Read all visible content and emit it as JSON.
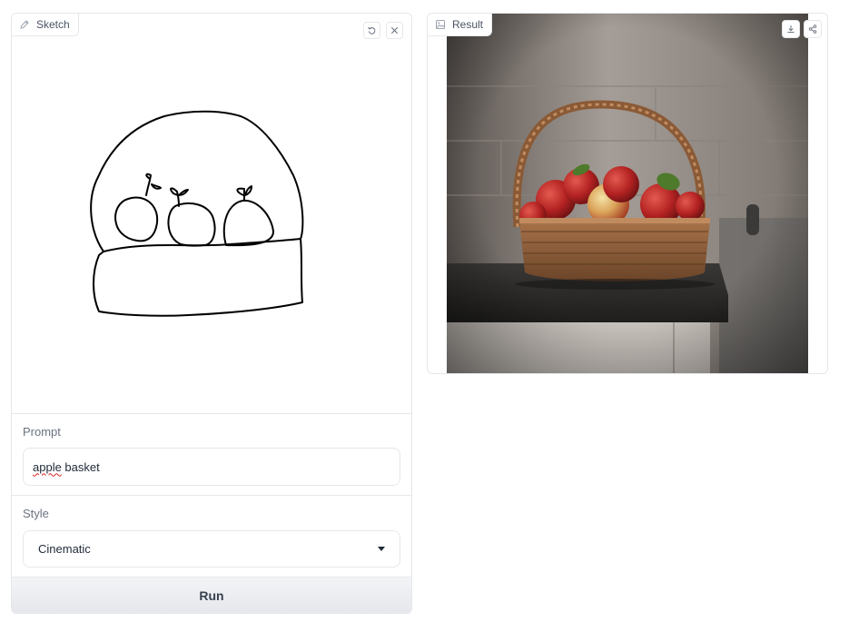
{
  "sketch": {
    "label": "Sketch",
    "label_icon": "pencil-icon",
    "undo_icon": "undo-icon",
    "clear_icon": "close-icon"
  },
  "prompt": {
    "label": "Prompt",
    "value_misspelled": "apple",
    "value_rest": " basket"
  },
  "style": {
    "label": "Style",
    "selected": "Cinematic"
  },
  "run_button": {
    "label": "Run"
  },
  "result": {
    "label": "Result",
    "label_icon": "image-icon",
    "download_icon": "download-icon",
    "share_icon": "share-icon"
  },
  "colors": {
    "border": "#e5e7eb",
    "spellcheck": "#dc2626",
    "button_bg": "#e5e7eb"
  }
}
